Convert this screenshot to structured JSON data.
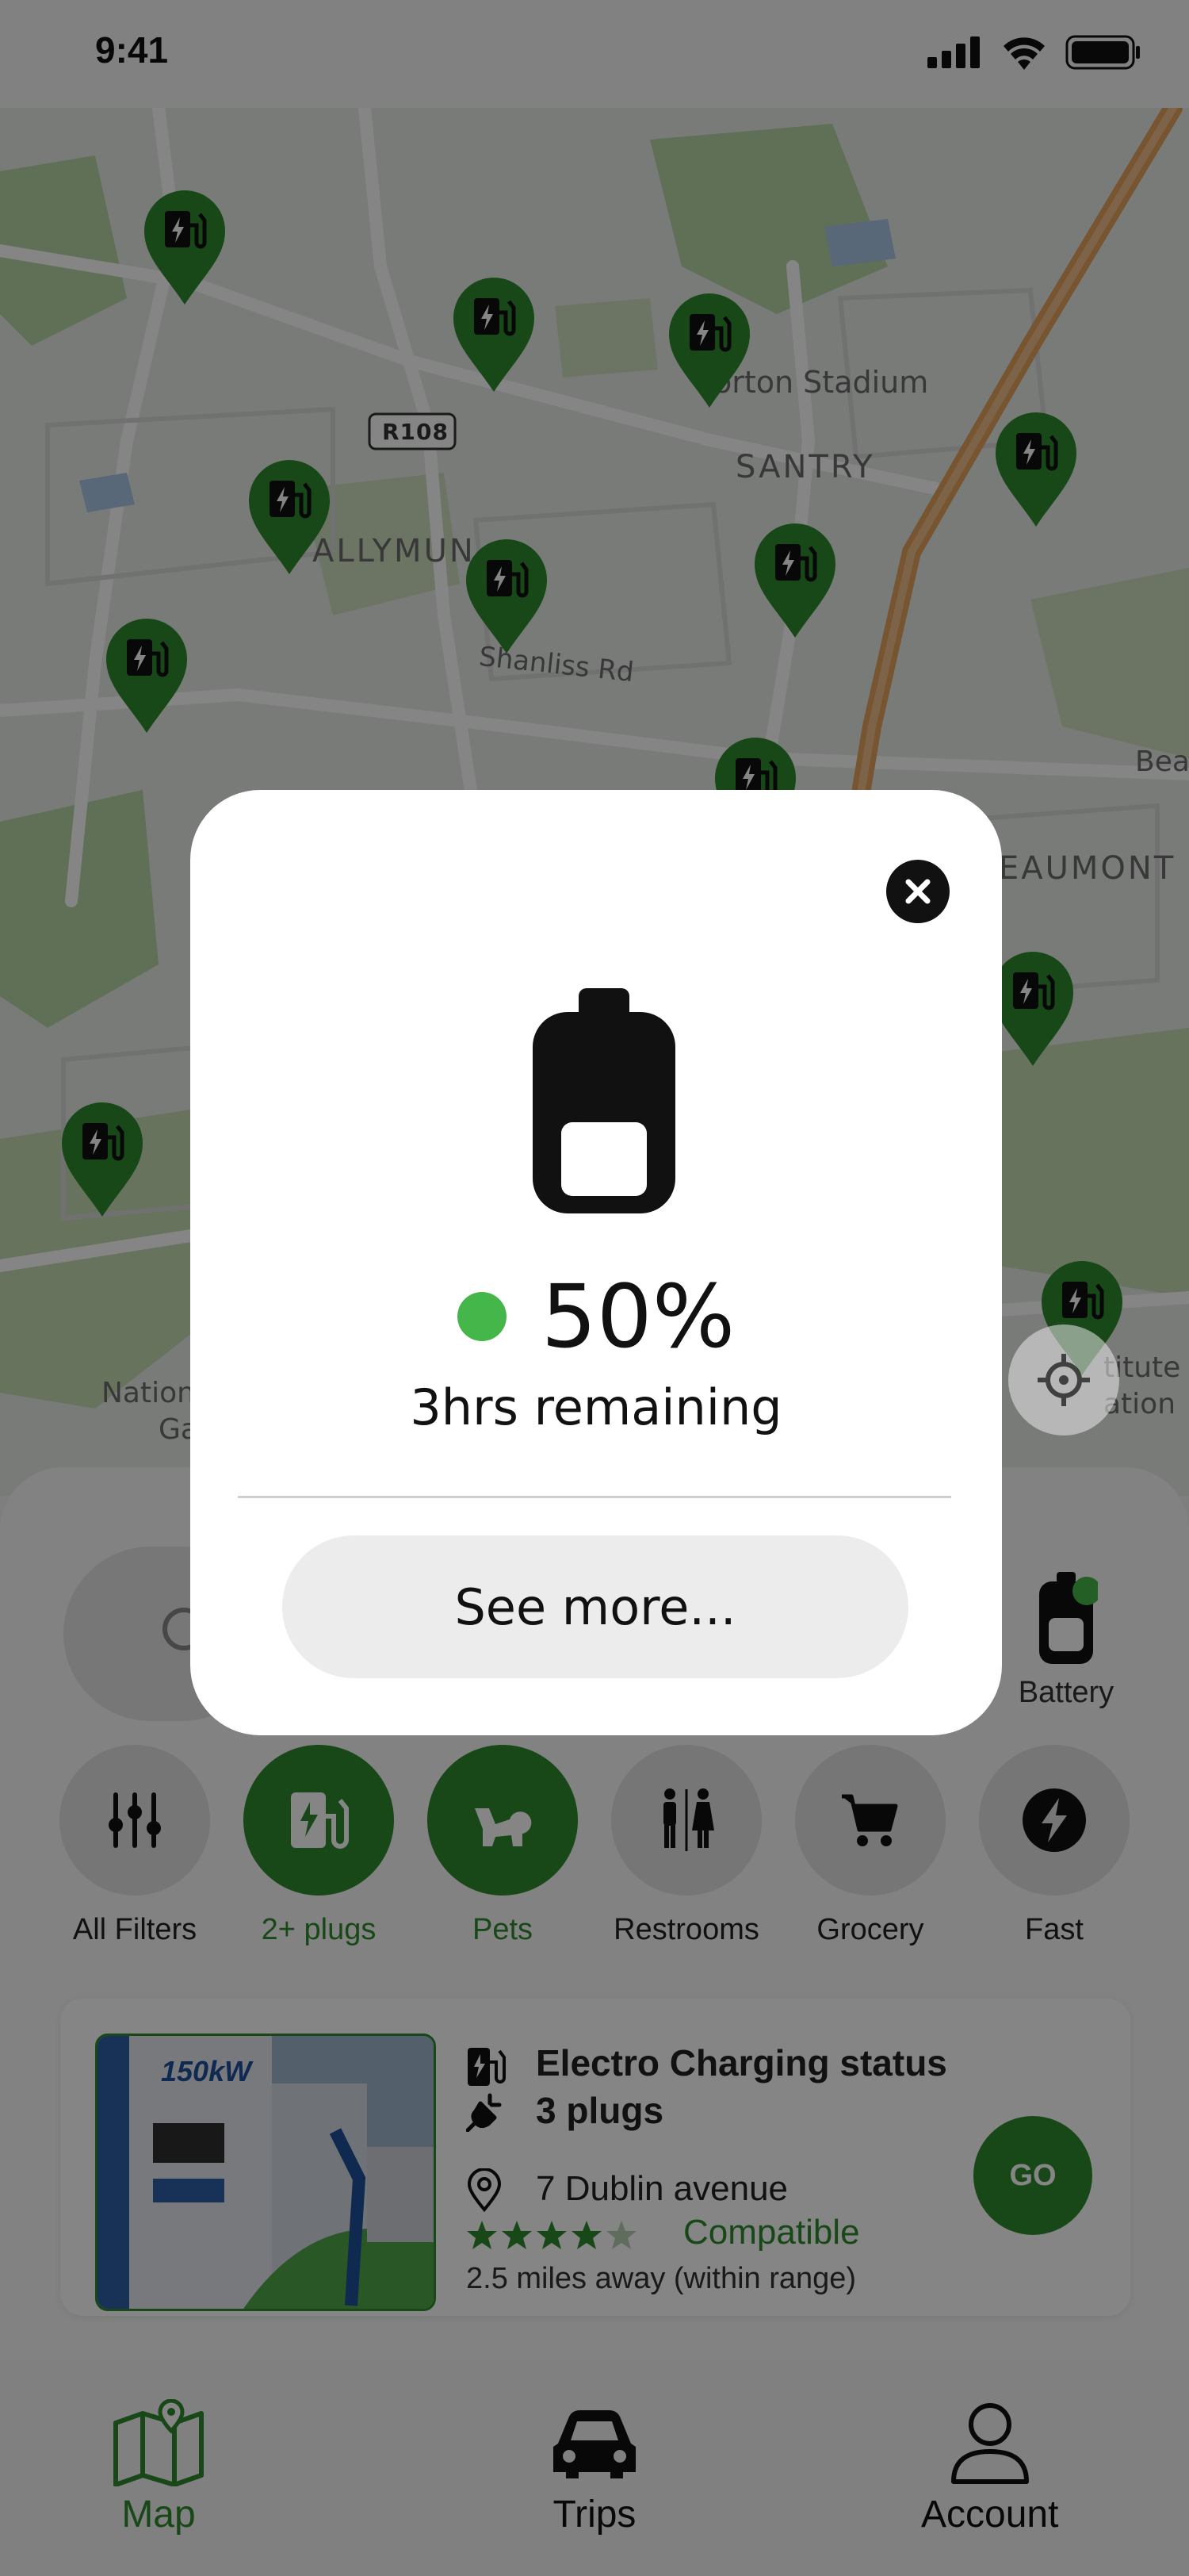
{
  "status_bar": {
    "time": "9:41"
  },
  "map": {
    "labels": {
      "stadium": "orton Stadium",
      "santry": "SANTRY",
      "ballymun": "ALLYMUN",
      "road_badge": "R108",
      "shanliss": "Shanliss Rd",
      "beaumont": "EAUMONT",
      "bea": "Bea",
      "national_a": "Nation",
      "national_b": "Ga",
      "institute_a": "titute",
      "institute_b": "ation"
    }
  },
  "sheet": {
    "battery_label": "Battery",
    "filters": [
      {
        "label": "All Filters",
        "icon": "sliders-icon",
        "active": false
      },
      {
        "label": "2+ plugs",
        "icon": "charging-station-icon",
        "active": true
      },
      {
        "label": "Pets",
        "icon": "pet-icon",
        "active": true
      },
      {
        "label": "Restrooms",
        "icon": "restroom-icon",
        "active": false
      },
      {
        "label": "Grocery",
        "icon": "cart-icon",
        "active": false
      },
      {
        "label": "Fast",
        "icon": "lightning-icon",
        "active": false
      }
    ],
    "card": {
      "title": "Electro Charging status",
      "plugs": "3 plugs",
      "address": "7 Dublin avenue",
      "rating": 4,
      "rating_max": 5,
      "compat": "Compatible",
      "distance": "2.5 miles away (within range)",
      "go_label": "GO",
      "image_text": "150kW"
    }
  },
  "nav": {
    "map": "Map",
    "trips": "Trips",
    "account": "Account"
  },
  "modal": {
    "percent": "50%",
    "battery_level": 0.5,
    "remaining": "3hrs remaining",
    "see_more": "See more..."
  },
  "colors": {
    "accent": "#2e8b2e",
    "status_dot": "#45b649"
  }
}
